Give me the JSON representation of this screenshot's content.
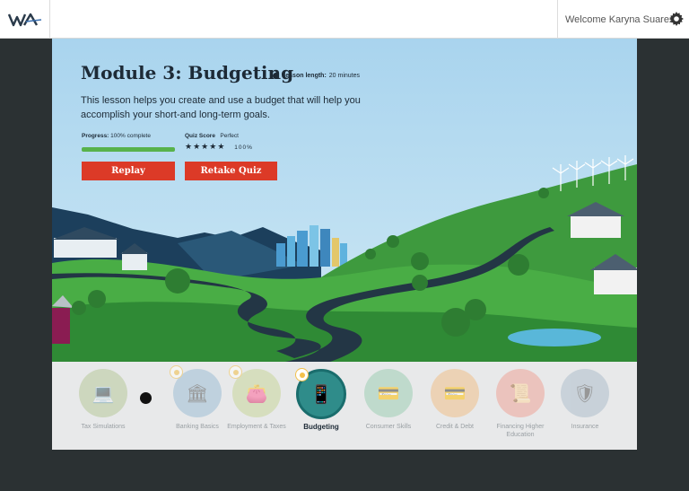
{
  "header": {
    "logo_text": "WA",
    "welcome": "Welcome Karyna Suarez",
    "settings_icon": "gear-icon"
  },
  "lesson": {
    "title": "Module 3: Budgeting",
    "length_label": "Lesson length:",
    "length_value": "20 minutes",
    "description": "This lesson helps you create and use a budget that will help you accomplish your short-and long-term goals.",
    "progress_label": "Progress:",
    "progress_value": "100% complete",
    "progress_fraction": 1.0,
    "quiz_label": "Quiz Score",
    "quiz_value": "Perfect",
    "quiz_stars": 5,
    "quiz_percent": "100%",
    "replay_label": "Replay",
    "retake_label": "Retake Quiz"
  },
  "colors": {
    "accent_red": "#dc3a27",
    "active_teal": "#1a6d6d",
    "progress_green": "#58b24b"
  },
  "modules": [
    {
      "label": "Tax Simulations",
      "icon": "laptop-icon",
      "color": "#b7c99b",
      "badge": false,
      "active": false
    },
    {
      "label": "Banking Basics",
      "icon": "bank-icon",
      "color": "#9ebfd6",
      "badge": true,
      "active": false
    },
    {
      "label": "Employment & Taxes",
      "icon": "wallet-icon",
      "color": "#c9d69b",
      "badge": true,
      "active": false
    },
    {
      "label": "Budgeting",
      "icon": "phone-chart-icon",
      "color": "#2f8c8a",
      "badge": true,
      "active": true
    },
    {
      "label": "Consumer Skills",
      "icon": "card-reader-icon",
      "color": "#9fcfb4",
      "badge": false,
      "active": false
    },
    {
      "label": "Credit & Debt",
      "icon": "credit-card-icon",
      "color": "#f0c08a",
      "badge": false,
      "active": false
    },
    {
      "label": "Financing Higher Education",
      "icon": "diploma-icon",
      "color": "#efa59a",
      "badge": false,
      "active": false
    },
    {
      "label": "Insurance",
      "icon": "shield-icon",
      "color": "#aebfcc",
      "badge": false,
      "active": false
    }
  ]
}
